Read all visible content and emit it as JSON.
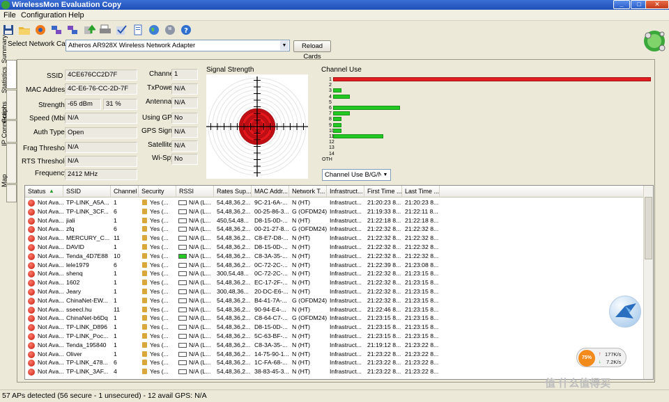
{
  "window": {
    "title": "WirelessMon Evaluation Copy",
    "controls": [
      "_",
      "□",
      "✕"
    ]
  },
  "menu": [
    "File",
    "Configuration",
    "Help"
  ],
  "toolbar_icons": [
    "save-icon",
    "open-folder-icon",
    "record-icon",
    "network-icon",
    "network2-icon",
    "export-icon",
    "print-icon",
    "check-icon",
    "clipboard-icon",
    "globe-icon",
    "globe2-icon",
    "help-icon"
  ],
  "network_card": {
    "label": "Select Network Card",
    "value": "Atheros AR928X Wireless Network Adapter",
    "reload": "Reload Cards"
  },
  "side_tabs": [
    "Summary",
    "Statistics",
    "Graphs",
    "IP Connection",
    "Map"
  ],
  "summary": {
    "left": [
      {
        "label": "SSID",
        "value": "4CE676CC2D7F"
      },
      {
        "label": "MAC Address",
        "value": "4C-E6-76-CC-2D-7F"
      },
      {
        "label": "Strength",
        "value": "-65 dBm",
        "value2": "31 %"
      },
      {
        "label": "Speed (Mbits)",
        "value": "N/A"
      },
      {
        "label": "Auth Type",
        "value": "Open"
      },
      {
        "label": "Frag Threshold",
        "value": "N/A"
      },
      {
        "label": "RTS Threshold",
        "value": "N/A"
      },
      {
        "label": "Frequency",
        "value": "2412 MHz"
      }
    ],
    "mid": [
      {
        "label": "Channel",
        "value": "1"
      },
      {
        "label": "TxPower",
        "value": "N/A"
      },
      {
        "label": "Antennas",
        "value": "N/A"
      },
      {
        "label": "Using GPS",
        "value": "No"
      },
      {
        "label": "GPS Signal",
        "value": "N/A"
      },
      {
        "label": "Satellites",
        "value": "N/A"
      },
      {
        "label": "Wi-Spy",
        "value": "No"
      }
    ]
  },
  "signal_strength": {
    "label": "Signal Strength",
    "level_fraction": 0.31
  },
  "channel_use": {
    "label": "Channel Use",
    "channels": [
      "1",
      "2",
      "3",
      "4",
      "5",
      "6",
      "7",
      "8",
      "9",
      "10",
      "11",
      "12",
      "13",
      "14",
      "OTH"
    ],
    "counts": [
      38,
      0,
      1,
      2,
      0,
      8,
      2,
      1,
      1,
      1,
      6,
      0,
      0,
      0,
      0
    ],
    "max": 38,
    "highlight_color": "#e02020",
    "bar_color": "#22c922",
    "mode_select": "Channel Use B/G/N"
  },
  "table": {
    "columns": [
      "Status",
      "SSID",
      "Channel",
      "Security",
      "RSSI",
      "Rates Sup...",
      "MAC Addr...",
      "Network T...",
      "Infrastruct...",
      "First Time ...",
      "Last Time ..."
    ],
    "rows": [
      [
        "Not Ava...",
        "TP-LINK_A5A...",
        "1",
        "Yes (...",
        "N/A (L...",
        "54,48,36,2...",
        "9C-21-6A-...",
        "N (HT)",
        "Infrastruct...",
        "21:20:23 8...",
        "21:20:23 8..."
      ],
      [
        "Not Ava...",
        "TP-LINK_3CF...",
        "6",
        "Yes (...",
        "N/A (L...",
        "54,48,36,2...",
        "00-25-86-3...",
        "G (OFDM24)",
        "Infrastruct...",
        "21:19:33 8...",
        "21:22:11 8..."
      ],
      [
        "Not Ava...",
        "jiali",
        "1",
        "Yes (...",
        "N/A (L...",
        "450,54,48...",
        "D8-15-0D-...",
        "N (HT)",
        "Infrastruct...",
        "21:22:18 8...",
        "21:22:18 8..."
      ],
      [
        "Not Ava...",
        "zfq",
        "6",
        "Yes (...",
        "N/A (L...",
        "54,48,36,2...",
        "00-21-27-8...",
        "G (OFDM24)",
        "Infrastruct...",
        "21:22:32 8...",
        "21:22:32 8..."
      ],
      [
        "Not Ava...",
        "MERCURY_C...",
        "11",
        "Yes (...",
        "N/A (L...",
        "54,48,36,2...",
        "C8-E7-D8-...",
        "N (HT)",
        "Infrastruct...",
        "21:22:32 8...",
        "21:22:32 8..."
      ],
      [
        "Not Ava...",
        "DAVID",
        "1",
        "Yes (...",
        "N/A (L...",
        "54,48,36,2...",
        "D8-15-0D-...",
        "N (HT)",
        "Infrastruct...",
        "21:22:32 8...",
        "21:22:32 8..."
      ],
      [
        "Not Ava...",
        "Tenda_4D7E88",
        "10",
        "Yes (...",
        "N/A (L...",
        "54,48,36,2...",
        "C8-3A-35-...",
        "N (HT)",
        "Infrastruct...",
        "21:22:32 8...",
        "21:22:32 8..."
      ],
      [
        "Not Ava...",
        "lele1979",
        "6",
        "Yes (...",
        "N/A (L...",
        "54,48,36,2...",
        "0C-72-2C-...",
        "N (HT)",
        "Infrastruct...",
        "21:22:39 8...",
        "21:23:08 8..."
      ],
      [
        "Not Ava...",
        "shenq",
        "1",
        "Yes (...",
        "N/A (L...",
        "300,54,48...",
        "0C-72-2C-...",
        "N (HT)",
        "Infrastruct...",
        "21:22:32 8...",
        "21:23:15 8..."
      ],
      [
        "Not Ava...",
        "1602",
        "1",
        "Yes (...",
        "N/A (L...",
        "54,48,36,2...",
        "EC-17-2F-...",
        "N (HT)",
        "Infrastruct...",
        "21:22:32 8...",
        "21:23:15 8..."
      ],
      [
        "Not Ava...",
        "Jeary",
        "1",
        "Yes (...",
        "N/A (L...",
        "300,48,36...",
        "20-DC-E6-...",
        "N (HT)",
        "Infrastruct...",
        "21:22:32 8...",
        "21:23:15 8..."
      ],
      [
        "Not Ava...",
        "ChinaNet-EW...",
        "1",
        "Yes (...",
        "N/A (L...",
        "54,48,36,2...",
        "B4-41-7A-...",
        "G (OFDM24)",
        "Infrastruct...",
        "21:22:32 8...",
        "21:23:15 8..."
      ],
      [
        "Not Ava...",
        "sseecl.hu",
        "11",
        "Yes (...",
        "N/A (L...",
        "54,48,36,2...",
        "90-94-E4-...",
        "N (HT)",
        "Infrastruct...",
        "21:22:46 8...",
        "21:23:15 8..."
      ],
      [
        "Not Ava...",
        "ChinaNet-b6Dq",
        "1",
        "Yes (...",
        "N/A (L...",
        "54,48,36,2...",
        "C8-64-C7-...",
        "G (OFDM24)",
        "Infrastruct...",
        "21:23:15 8...",
        "21:23:15 8..."
      ],
      [
        "Not Ava...",
        "TP-LINK_D896",
        "1",
        "Yes (...",
        "N/A (L...",
        "54,48,36,2...",
        "D8-15-0D-...",
        "N (HT)",
        "Infrastruct...",
        "21:23:15 8...",
        "21:23:15 8..."
      ],
      [
        "Not Ava...",
        "TP-LINK_Poc...",
        "1",
        "Yes (...",
        "N/A (L...",
        "54,48,36,2...",
        "5C-63-BF-...",
        "N (HT)",
        "Infrastruct...",
        "21:23:15 8...",
        "21:23:15 8..."
      ],
      [
        "Not Ava...",
        "Tenda_195840",
        "1",
        "Yes (...",
        "N/A (L...",
        "54,48,36,2...",
        "C8-3A-35-...",
        "N (HT)",
        "Infrastruct...",
        "21:19:12 8...",
        "21:23:22 8..."
      ],
      [
        "Not Ava...",
        "Oliver",
        "1",
        "Yes (...",
        "N/A (L...",
        "54,48,36,2...",
        "14-75-90-1...",
        "N (HT)",
        "Infrastruct...",
        "21:23:22 8...",
        "21:23:22 8..."
      ],
      [
        "Not Ava...",
        "TP-LINK_478...",
        "6",
        "Yes (...",
        "N/A (L...",
        "54,48,36,2...",
        "1C-FA-68-...",
        "N (HT)",
        "Infrastruct...",
        "21:23:22 8...",
        "21:23:22 8..."
      ],
      [
        "Not Ava...",
        "TP-LINK_3AF...",
        "4",
        "Yes (...",
        "N/A (L...",
        "54,48,36,2...",
        "38-83-45-3...",
        "N (HT)",
        "Infrastruct...",
        "21:23:22 8...",
        "21:23:22 8..."
      ]
    ],
    "rssi_on_row": 6
  },
  "status_bar": "57 APs detected (56 secure - 1 unsecured) - 12 avail  GPS: N/A",
  "speed_widget": {
    "percent": "75%",
    "up": "177K/s",
    "down": "7.2K/s"
  },
  "watermark": "值 什么值得买"
}
